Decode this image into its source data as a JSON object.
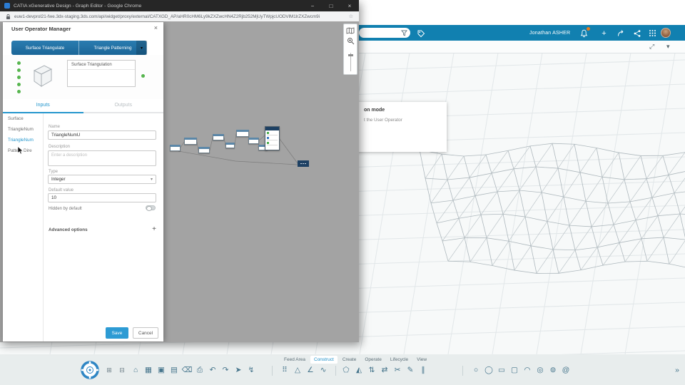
{
  "browser": {
    "title": "CATIA xGenerative Design - Graph Editor - Google Chrome",
    "url": "euw1-devprol21-fwe.3dx-staging.3ds.com/api/widget/proxy/external/CATXGD_AP/aHR0cHM6Ly9kZXZwcHN4Z2Rjb252MjUyTWpjcUODVlM1lrZXZwcm9i",
    "controls": {
      "minimize": "−",
      "maximize": "□",
      "close": "×"
    }
  },
  "top_bar": {
    "user_name": "Jonathan ASHER"
  },
  "popup": {
    "title": "on mode",
    "body": "t the User Operator"
  },
  "dialog": {
    "title": "User Operator Manager",
    "close": "×",
    "operator_tabs": [
      {
        "name": "operator-tab-surface-triangulate",
        "label": "Surface Triangulate"
      },
      {
        "name": "operator-tab-triangle-patterning",
        "label": "Triangle Patterning"
      }
    ],
    "preview_node": "Surface Triangulation",
    "tabs": [
      {
        "name": "tab-inputs",
        "label": "Inputs",
        "active": true
      },
      {
        "name": "tab-outputs",
        "label": "Outputs"
      }
    ],
    "params": [
      {
        "name": "param-surface",
        "label": "Surface"
      },
      {
        "name": "param-trianglenum-v",
        "label": "TriangleNum"
      },
      {
        "name": "param-trianglenum-u",
        "label": "TriangleNum",
        "active": true
      },
      {
        "name": "param-pattern-direction",
        "label": "Pattern Dire"
      }
    ],
    "form": {
      "name_label": "Name",
      "name_value": "TriangleNumU",
      "description_label": "Description",
      "description_placeholder": "Enter a description",
      "type_label": "Type",
      "type_value": "Integer",
      "default_label": "Default value",
      "default_value": "10",
      "hidden_label": "Hidden by default",
      "advanced_label": "Advanced options",
      "advanced_add": "+"
    },
    "save": "Save",
    "cancel": "Cancel"
  },
  "action_bar": {
    "tabs": [
      {
        "name": "section-feed-area",
        "label": "Feed Area"
      },
      {
        "name": "section-construct",
        "label": "Construct",
        "active": true
      },
      {
        "name": "section-create",
        "label": "Create"
      },
      {
        "name": "section-operate",
        "label": "Operate"
      },
      {
        "name": "section-lifecycle",
        "label": "Lifecycle"
      },
      {
        "name": "section-view",
        "label": "View"
      }
    ]
  },
  "toolbar": {
    "file": [
      {
        "name": "home-icon",
        "glyph": "⌂"
      },
      {
        "name": "content-icon",
        "glyph": "▦"
      },
      {
        "name": "save-icon",
        "glyph": "▣"
      },
      {
        "name": "open-icon",
        "glyph": "▤"
      },
      {
        "name": "delete-icon",
        "glyph": "⌫"
      },
      {
        "name": "print-icon",
        "glyph": "⎙"
      },
      {
        "name": "undo-icon",
        "glyph": "↶"
      },
      {
        "name": "redo-icon",
        "glyph": "↷"
      },
      {
        "name": "select-icon",
        "glyph": "➤"
      },
      {
        "name": "update-icon",
        "glyph": "↯"
      }
    ],
    "view": [
      {
        "name": "grid-dots-icon",
        "glyph": "⠿"
      },
      {
        "name": "triangle-icon",
        "glyph": "△"
      },
      {
        "name": "polyline-icon",
        "glyph": "∠"
      },
      {
        "name": "curve-icon",
        "glyph": "∿"
      }
    ],
    "construct": [
      {
        "name": "pentagon-icon",
        "glyph": "⬠"
      },
      {
        "name": "mirror-icon",
        "glyph": "◭"
      },
      {
        "name": "swap-icon",
        "glyph": "⇅"
      },
      {
        "name": "exchange-icon",
        "glyph": "⇄"
      },
      {
        "name": "trim-icon",
        "glyph": "✂"
      },
      {
        "name": "sketch-icon",
        "glyph": "✎"
      },
      {
        "name": "hatch-icon",
        "glyph": "∥"
      }
    ],
    "create": [
      {
        "name": "circle-icon",
        "glyph": "○"
      },
      {
        "name": "ellipse-icon",
        "glyph": "◯"
      },
      {
        "name": "rectangle-icon",
        "glyph": "▭"
      },
      {
        "name": "rounded-rect-icon",
        "glyph": "▢"
      },
      {
        "name": "arc-icon",
        "glyph": "◠"
      },
      {
        "name": "target-icon",
        "glyph": "◎"
      },
      {
        "name": "rings-icon",
        "glyph": "⊚"
      },
      {
        "name": "spiral-icon",
        "glyph": "@"
      }
    ],
    "left_small": [
      {
        "name": "panel-toggle-icon",
        "glyph": "⊞"
      },
      {
        "name": "layers-toggle-icon",
        "glyph": "⊟"
      }
    ],
    "corner": [
      {
        "name": "more-tools-icon",
        "glyph": "»"
      }
    ]
  }
}
